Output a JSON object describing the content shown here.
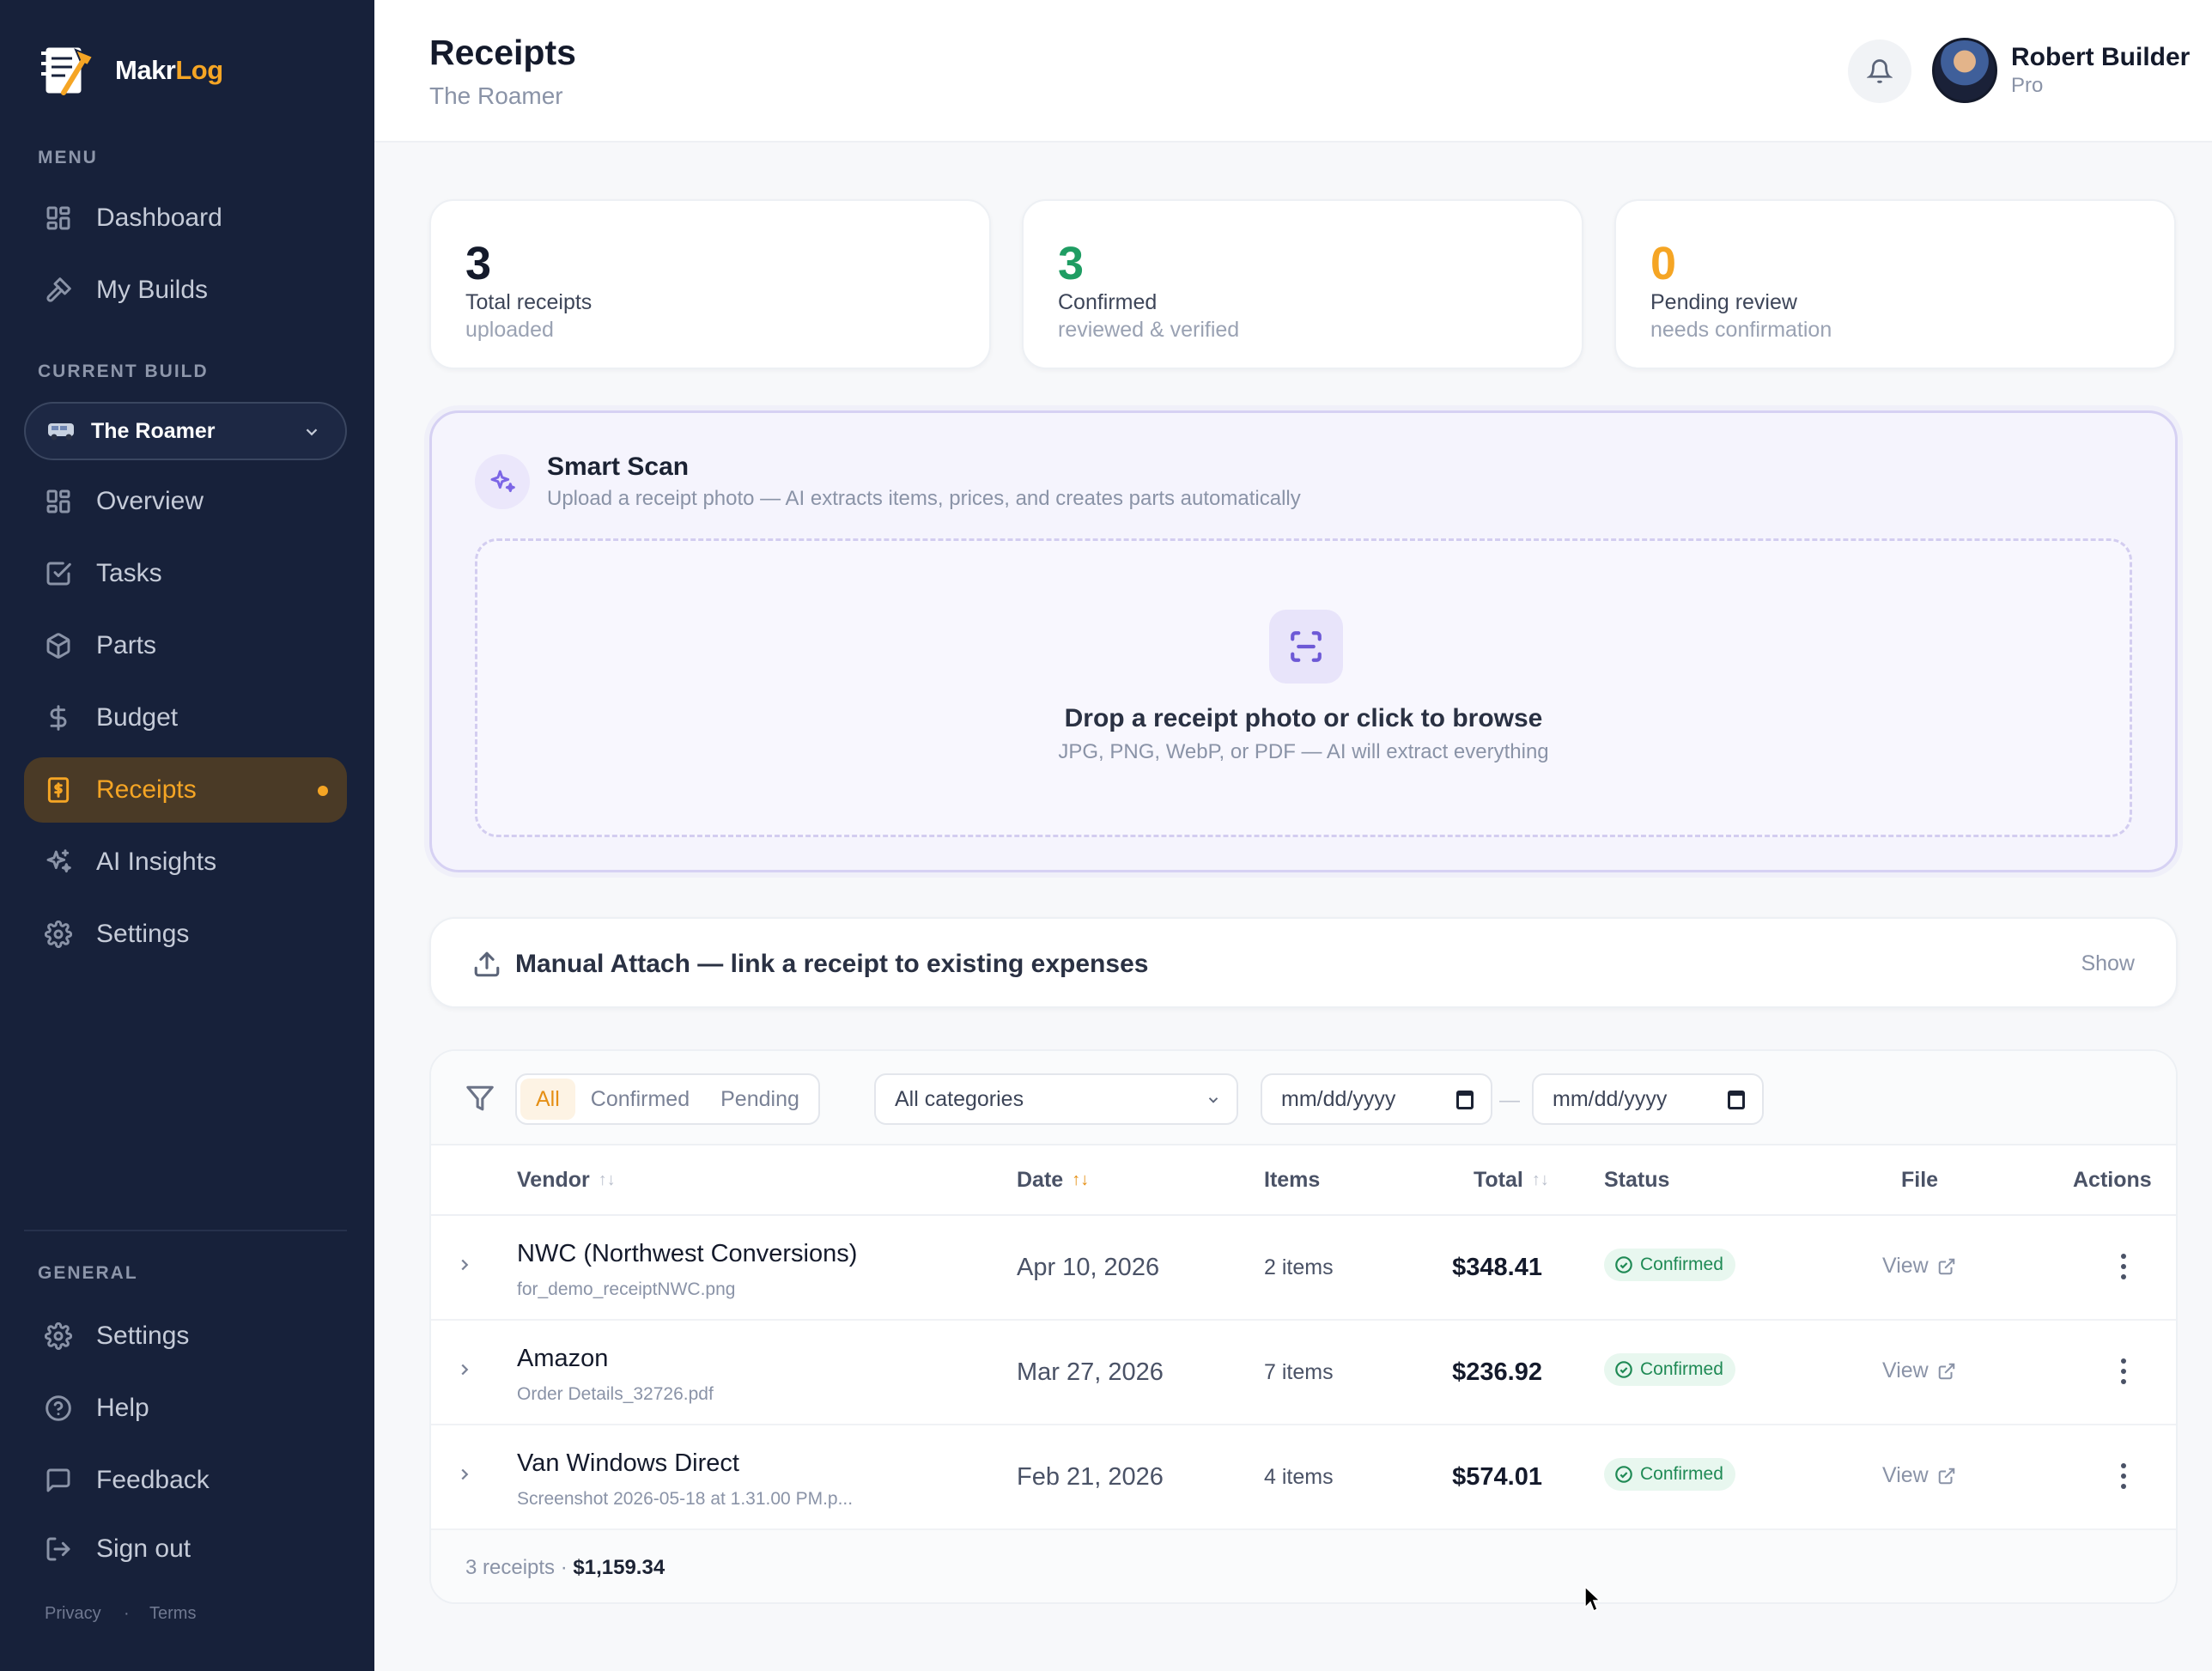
{
  "brand": {
    "name_part1": "Makr",
    "name_part2": "Log",
    "accent": "#f5a524"
  },
  "sidebar": {
    "menu_heading": "MENU",
    "menu": [
      {
        "label": "Dashboard",
        "icon": "grid-icon"
      },
      {
        "label": "My Builds",
        "icon": "hammer-icon"
      }
    ],
    "current_build_heading": "CURRENT BUILD",
    "current_build": "The Roamer",
    "build_nav": [
      {
        "label": "Overview",
        "icon": "grid-icon"
      },
      {
        "label": "Tasks",
        "icon": "checkbox-icon"
      },
      {
        "label": "Parts",
        "icon": "box-icon"
      },
      {
        "label": "Budget",
        "icon": "dollar-icon"
      },
      {
        "label": "Receipts",
        "icon": "receipt-icon",
        "active": true
      },
      {
        "label": "AI Insights",
        "icon": "sparkles-icon"
      },
      {
        "label": "Settings",
        "icon": "gear-icon"
      }
    ],
    "general_heading": "GENERAL",
    "general": [
      {
        "label": "Settings",
        "icon": "gear-icon"
      },
      {
        "label": "Help",
        "icon": "help-icon"
      },
      {
        "label": "Feedback",
        "icon": "message-icon"
      },
      {
        "label": "Sign out",
        "icon": "sign-out-icon"
      }
    ],
    "footer": {
      "privacy": "Privacy",
      "separator": "·",
      "terms": "Terms"
    }
  },
  "header": {
    "title": "Receipts",
    "subtitle": "The Roamer",
    "user": {
      "name": "Robert Builder",
      "plan": "Pro"
    }
  },
  "stats": [
    {
      "value": "3",
      "label": "Total receipts",
      "sub": "uploaded",
      "color": "#141a2b"
    },
    {
      "value": "3",
      "label": "Confirmed",
      "sub": "reviewed & verified",
      "color": "#1f9d63"
    },
    {
      "value": "0",
      "label": "Pending review",
      "sub": "needs confirmation",
      "color": "#f5a524"
    }
  ],
  "smart_scan": {
    "title": "Smart Scan",
    "subtitle": "Upload a receipt photo — AI extracts items, prices, and creates parts automatically",
    "drop_title": "Drop a receipt photo or click to browse",
    "drop_sub": "JPG, PNG, WebP, or PDF — AI will extract everything"
  },
  "manual_attach": {
    "title": "Manual Attach — link a receipt to existing expenses",
    "toggle": "Show"
  },
  "filters": {
    "segments": [
      "All",
      "Confirmed",
      "Pending"
    ],
    "active_segment": "All",
    "category": "All categories",
    "date_from": "mm/dd/yyyy",
    "date_to": "mm/dd/yyyy",
    "date_separator": "—"
  },
  "table": {
    "columns": {
      "vendor": "Vendor",
      "date": "Date",
      "items": "Items",
      "total": "Total",
      "status": "Status",
      "file": "File",
      "actions": "Actions"
    },
    "sort_icon": "↑↓",
    "rows": [
      {
        "vendor": "NWC (Northwest Conversions)",
        "file": "for_demo_receiptNWC.png",
        "date": "Apr 10, 2026",
        "items": "2 items",
        "total": "$348.41",
        "status": "Confirmed",
        "view": "View"
      },
      {
        "vendor": "Amazon",
        "file": "Order Details_32726.pdf",
        "date": "Mar 27, 2026",
        "items": "7 items",
        "total": "$236.92",
        "status": "Confirmed",
        "view": "View"
      },
      {
        "vendor": "Van Windows Direct",
        "file": "Screenshot 2026-05-18 at 1.31.00 PM.p...",
        "date": "Feb 21, 2026",
        "items": "4 items",
        "total": "$574.01",
        "status": "Confirmed",
        "view": "View"
      }
    ],
    "footer": {
      "count": "3 receipts",
      "separator": " · ",
      "sum": "$1,159.34"
    }
  }
}
